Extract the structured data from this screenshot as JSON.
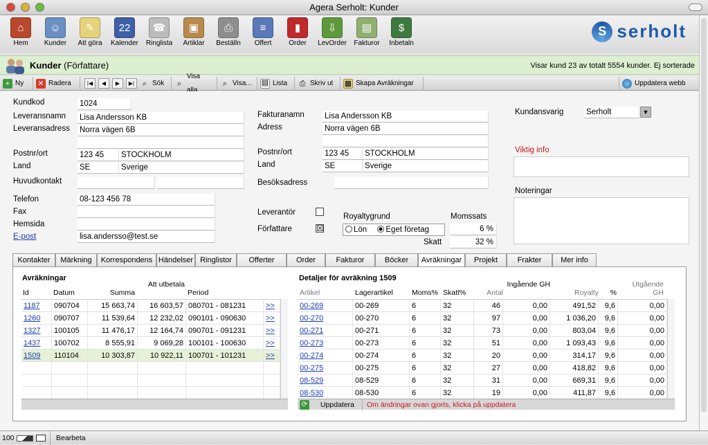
{
  "window": {
    "title": "Agera Serholt: Kunder"
  },
  "toolbar": {
    "items": [
      {
        "label": "Hem",
        "icon": "house-icon",
        "color": "#b8482e",
        "glyph": "⌂"
      },
      {
        "label": "Kunder",
        "icon": "people-icon",
        "color": "#6a8fc2",
        "glyph": "☺"
      },
      {
        "label": "Att göra",
        "icon": "notepad-icon",
        "color": "#e6d27a",
        "glyph": "✎"
      },
      {
        "label": "Kalender",
        "icon": "calendar-icon",
        "color": "#3f5fa8",
        "glyph": "22"
      },
      {
        "label": "Ringlista",
        "icon": "phone-icon",
        "color": "#bcbcbc",
        "glyph": "☎"
      },
      {
        "label": "Artiklar",
        "icon": "box-icon",
        "color": "#b98a4e",
        "glyph": "▣"
      },
      {
        "label": "Beställn",
        "icon": "fax-icon",
        "color": "#8e8e8e",
        "glyph": "⎙"
      },
      {
        "label": "Offert",
        "icon": "document-icon",
        "color": "#5b78b8",
        "glyph": "≡"
      },
      {
        "label": "Order",
        "icon": "book-icon",
        "color": "#c02a2a",
        "glyph": "▮"
      },
      {
        "label": "LevOrder",
        "icon": "delivery-icon",
        "color": "#5e9a3c",
        "glyph": "⇩"
      },
      {
        "label": "Fakturor",
        "icon": "invoice-icon",
        "color": "#8fb070",
        "glyph": "▤"
      },
      {
        "label": "Inbetaln",
        "icon": "money-icon",
        "color": "#3e7a3e",
        "glyph": "$"
      }
    ]
  },
  "brand": {
    "logo_text": "serholt",
    "accent": "#1e5aa8"
  },
  "header": {
    "title": "Kunder",
    "subtitle": "(Författare)",
    "info": "Visar kund 23 av totalt 5554 kunder. Ej sorterade"
  },
  "actions": {
    "new": "Ny",
    "delete": "Radera",
    "search": "Sök",
    "show_all": "Visa alla",
    "show": "Visa...",
    "list": "Lista",
    "print": "Skriv ut",
    "create_settlements": "Skapa Avräkningar",
    "update_web": "Uppdatera webb"
  },
  "form": {
    "kundkod": {
      "label": "Kundkod",
      "value": "1024"
    },
    "leveransnamn": {
      "label": "Leveransnamn",
      "value": "Lisa Andersson KB"
    },
    "leveransadress": {
      "label": "Leveransadress",
      "value": "Norra vägen 6B",
      "value2": ""
    },
    "postnr_ort": {
      "label": "Postnr/ort",
      "postnr": "123 45",
      "ort": "STOCKHOLM"
    },
    "land": {
      "label": "Land",
      "code": "SE",
      "name": "Sverige"
    },
    "huvudkontakt": {
      "label": "Huvudkontakt",
      "value": "",
      "value2": ""
    },
    "telefon": {
      "label": "Telefon",
      "value": "08-123 456 78"
    },
    "fax": {
      "label": "Fax",
      "value": ""
    },
    "hemsida": {
      "label": "Hemsida",
      "value": ""
    },
    "epost": {
      "label": "E-post",
      "value": "lisa.andersso@test.se"
    },
    "fakturanamn": {
      "label": "Fakturanamn",
      "value": "Lisa Andersson KB"
    },
    "adress": {
      "label": "Adress",
      "value": "Norra vägen 6B",
      "value2": ""
    },
    "f_postnr_ort": {
      "label": "Postnr/ort",
      "postnr": "123 45",
      "ort": "STOCKHOLM"
    },
    "f_land": {
      "label": "Land",
      "code": "SE",
      "name": "Sverige"
    },
    "besoksadress": {
      "label": "Besöksadress",
      "value": ""
    },
    "leverantor": {
      "label": "Leverantör",
      "checked": ""
    },
    "forfattare": {
      "label": "Författare",
      "checked": "☒"
    },
    "royaltygrund": {
      "label": "Royaltygrund",
      "opt1": "Lön",
      "opt2": "Eget företag"
    },
    "momssats": {
      "label": "Momssats",
      "value": "6 %"
    },
    "skatt": {
      "label": "Skatt",
      "value": "32 %"
    },
    "kundansvarig": {
      "label": "Kundansvarig",
      "value": "Serholt"
    },
    "viktig_info": {
      "label": "Viktig info",
      "value": ""
    },
    "noteringar": {
      "label": "Noteringar",
      "value": ""
    }
  },
  "tabs": [
    "Kontakter",
    "Märkning",
    "Korrespondens",
    "Händelser",
    "Ringlistor",
    "Offerter",
    "Order",
    "Fakturor",
    "Böcker",
    "Avräkningar",
    "Projekt",
    "Frakter",
    "Mer info"
  ],
  "active_tab": "Avräkningar",
  "settlements": {
    "title": "Avräkningar",
    "columns": [
      "Id",
      "Datum",
      "Summa",
      "Att utbetala",
      "Period"
    ],
    "rows": [
      {
        "id": "1187",
        "datum": "090704",
        "summa": "15 663,74",
        "att": "16 603,57",
        "period": "080701  - 081231"
      },
      {
        "id": "1260",
        "datum": "090707",
        "summa": "11 539,64",
        "att": "12 232,02",
        "period": "090101  - 090630"
      },
      {
        "id": "1327",
        "datum": "100105",
        "summa": "11 476,17",
        "att": "12 164,74",
        "period": "090701  - 091231"
      },
      {
        "id": "1437",
        "datum": "100702",
        "summa": "8 555,91",
        "att": "9 069,28",
        "period": "100101  - 100630"
      },
      {
        "id": "1509",
        "datum": "110104",
        "summa": "10 303,87",
        "att": "10 922,11",
        "period": "100701  - 101231"
      }
    ],
    "link_glyph": ">>"
  },
  "details": {
    "title": "Detaljer för avräkning 1509",
    "columns": [
      "Artikel",
      "Lagerartikel",
      "Moms%",
      "Skatt%",
      "Antal",
      "Ingående GH",
      "Royalty",
      "%",
      "Utgående GH"
    ],
    "rows": [
      {
        "artikel": "00-269",
        "lager": "00-269",
        "moms": "6",
        "skatt": "32",
        "antal": "46",
        "in": "0,00",
        "royalty": "491,52",
        "pct": "9,6",
        "ut": "0,00"
      },
      {
        "artikel": "00-270",
        "lager": "00-270",
        "moms": "6",
        "skatt": "32",
        "antal": "97",
        "in": "0,00",
        "royalty": "1 036,20",
        "pct": "9,6",
        "ut": "0,00"
      },
      {
        "artikel": "00-271",
        "lager": "00-271",
        "moms": "6",
        "skatt": "32",
        "antal": "73",
        "in": "0,00",
        "royalty": "803,04",
        "pct": "9,6",
        "ut": "0,00"
      },
      {
        "artikel": "00-273",
        "lager": "00-273",
        "moms": "6",
        "skatt": "32",
        "antal": "51",
        "in": "0,00",
        "royalty": "1 093,43",
        "pct": "9,6",
        "ut": "0,00"
      },
      {
        "artikel": "00-274",
        "lager": "00-274",
        "moms": "6",
        "skatt": "32",
        "antal": "20",
        "in": "0,00",
        "royalty": "314,17",
        "pct": "9,6",
        "ut": "0,00"
      },
      {
        "artikel": "00-275",
        "lager": "00-275",
        "moms": "6",
        "skatt": "32",
        "antal": "27",
        "in": "0,00",
        "royalty": "418,82",
        "pct": "9,6",
        "ut": "0,00"
      },
      {
        "artikel": "08-529",
        "lager": "08-529",
        "moms": "6",
        "skatt": "32",
        "antal": "31",
        "in": "0,00",
        "royalty": "669,31",
        "pct": "9,6",
        "ut": "0,00"
      },
      {
        "artikel": "08-530",
        "lager": "08-530",
        "moms": "6",
        "skatt": "32",
        "antal": "19",
        "in": "0,00",
        "royalty": "411,87",
        "pct": "9,6",
        "ut": "0,00"
      }
    ],
    "update_label": "Uppdatera",
    "warning": "Om ändringar ovan gjorts, klicka på uppdatera"
  },
  "statusbar": {
    "zoom": "100",
    "mode": "Bearbeta"
  }
}
